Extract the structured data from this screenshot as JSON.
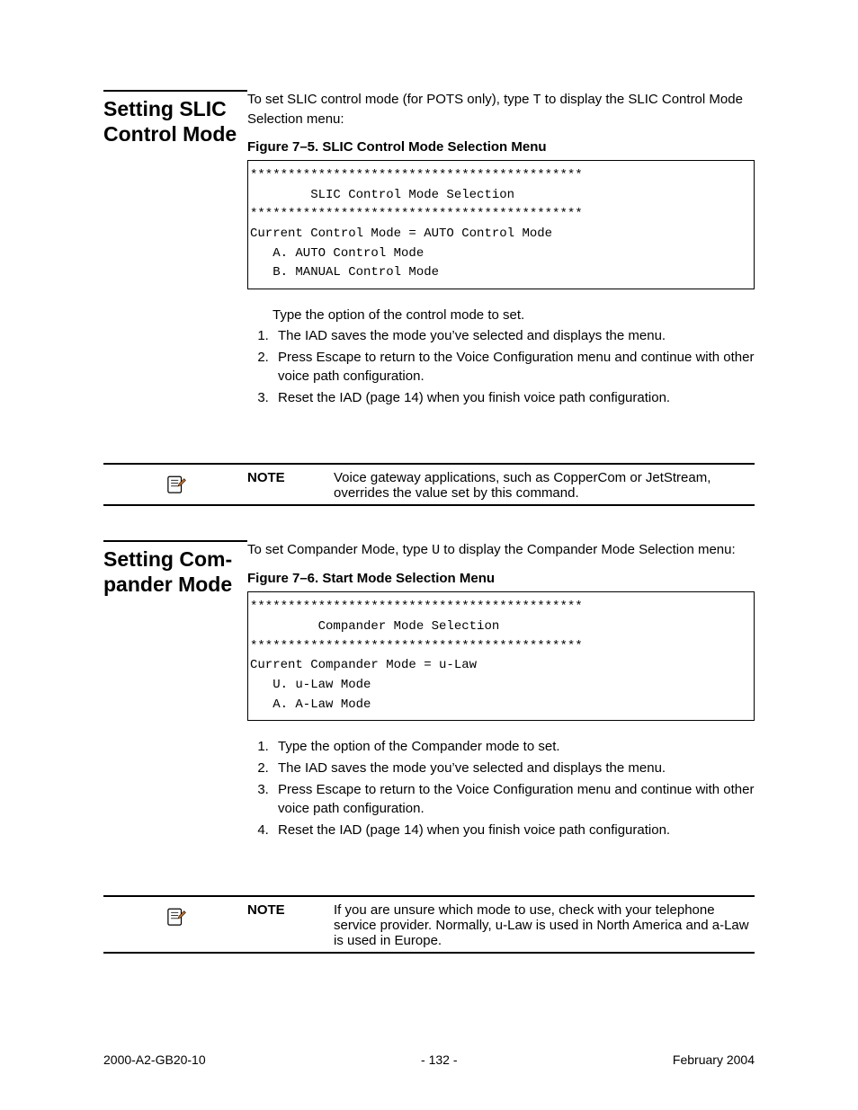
{
  "section1": {
    "heading": "Setting SLIC Con­trol Mode",
    "intro_a": "To set SLIC control mode (for POTS only), type ",
    "intro_key": "T",
    "intro_b": " to display the SLIC Control Mode Selection menu:",
    "fig_caption": "Figure 7–5.  SLIC Control Mode Selection Menu",
    "console": "********************************************\n        SLIC Control Mode Selection\n********************************************\nCurrent Control Mode = AUTO Control Mode\n   A. AUTO Control Mode\n   B. MANUAL Control Mode",
    "lead": "Type the option of the control mode to set.",
    "steps": [
      "The IAD saves the mode you’ve selected and displays the menu.",
      "Press Escape to return to the Voice Configuration menu and continue with other voice path configuration.",
      "Reset the IAD (page 14) when you finish voice path configuration."
    ],
    "note_label": "NOTE",
    "note_text": "Voice gateway applications, such as CopperCom or JetStream, overrides the value set by this command."
  },
  "section2": {
    "heading": "Setting Com­pander Mode",
    "intro_a": "To set Compander Mode, type ",
    "intro_key": "U",
    "intro_b": " to display the Compander Mode Selection menu:",
    "fig_caption": "Figure 7–6.  Start Mode Selection Menu",
    "console": "********************************************\n         Compander Mode Selection\n********************************************\nCurrent Compander Mode = u-Law\n   U. u-Law Mode\n   A. A-Law Mode",
    "steps": [
      "Type the option of the Compander mode to set.",
      "The IAD saves the mode you’ve selected and displays the menu.",
      "Press Escape to return to the Voice Configuration menu and continue with other voice path configuration.",
      "Reset the IAD (page 14) when you finish voice path configuration."
    ],
    "note_label": "NOTE",
    "note_text": "If you are unsure which mode to use, check with your telephone service provider. Normally, u-Law is used in North America and a-Law is used in Europe."
  },
  "footer": {
    "left": "2000-A2-GB20-10",
    "center": "- 132 -",
    "right": "February 2004"
  }
}
